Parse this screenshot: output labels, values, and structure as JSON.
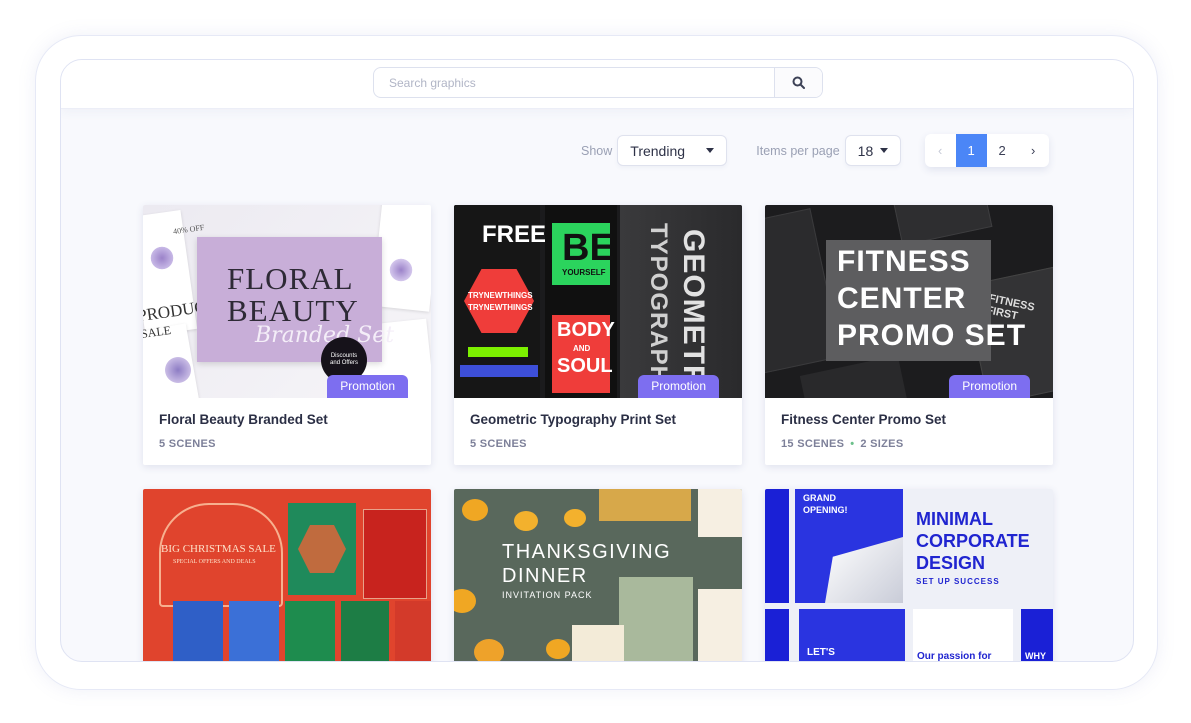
{
  "search": {
    "placeholder": "Search graphics",
    "icon": "search-icon"
  },
  "filters": {
    "show_label": "Show",
    "show_value": "Trending",
    "per_page_label": "Items per page",
    "per_page_value": "18"
  },
  "pagination": {
    "prev": "‹",
    "pages": [
      "1",
      "2"
    ],
    "active_page": "1",
    "next": "›"
  },
  "colors": {
    "accent": "#4b86f7",
    "badge": "#7d6ef0"
  },
  "cards": [
    {
      "title": "Floral Beauty Branded Set",
      "scenes": "5 SCENES",
      "badge": "Promotion",
      "thumb": {
        "line1": "FLORAL",
        "line2": "BEAUTY",
        "script": "Branded Set",
        "sticker": "Discounts and Offers",
        "side1": "40% OFF",
        "side2": "PRODUCT",
        "side3": "SALE"
      }
    },
    {
      "title": "Geometric Typography Print Set",
      "scenes": "5 SCENES",
      "badge": "Promotion",
      "thumb": {
        "free": "FREE",
        "be": "BE",
        "yourself": "YOURSELF",
        "body": "BODY",
        "and": "AND",
        "soul": "SOUL",
        "vert1": "GEOMETRIC",
        "vert2": "TYPOGRAPHY",
        "tag": "TRYNEWTHINGS"
      }
    },
    {
      "title": "Fitness Center Promo Set",
      "scenes": "15 SCENES",
      "sizes": "2 SIZES",
      "badge": "Promotion",
      "thumb": {
        "line1": "FITNESS",
        "line2": "CENTER",
        "line3": "PROMO SET",
        "side": "FITNESS FIRST"
      }
    },
    {
      "title": "",
      "thumb": {
        "headline": "BIG CHRISTMAS SALE",
        "sub": "SPECIAL OFFERS AND DEALS"
      }
    },
    {
      "title": "",
      "thumb": {
        "line1": "THANKSGIVING",
        "line2": "DINNER",
        "line3": "INVITATION PACK"
      }
    },
    {
      "title": "",
      "thumb": {
        "grand": "GRAND OPENING!",
        "line1": "MINIMAL",
        "line2": "CORPORATE",
        "line3": "DESIGN",
        "sub": "SET UP SUCCESS",
        "lets": "LET'S",
        "passion": "Our passion for",
        "why": "WHY"
      }
    }
  ]
}
